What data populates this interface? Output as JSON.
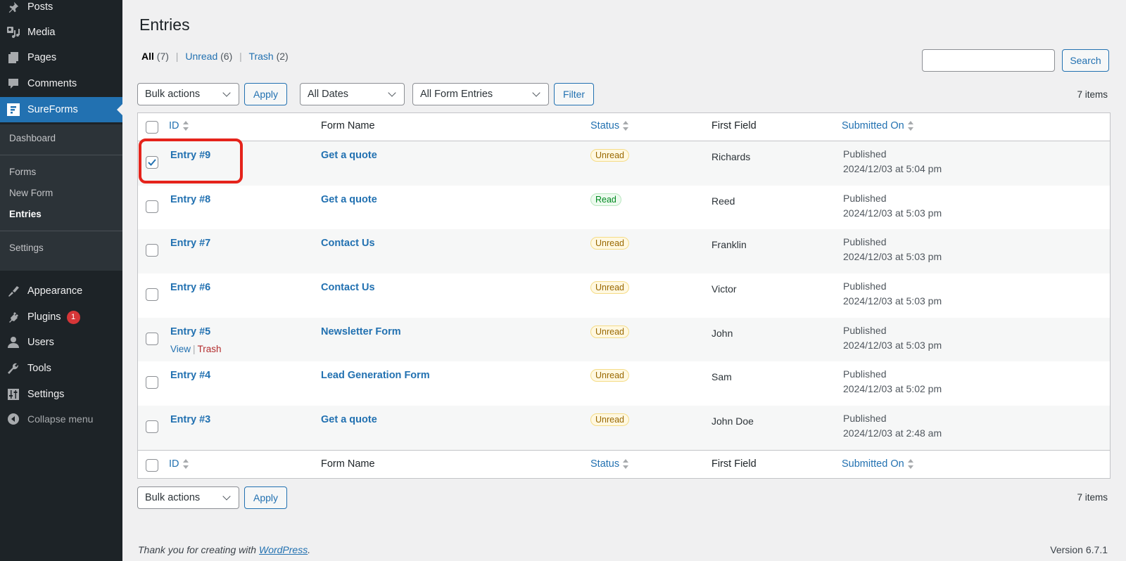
{
  "sidebar": {
    "items": [
      {
        "label": "Posts",
        "icon": "pin-icon"
      },
      {
        "label": "Media",
        "icon": "media-icon"
      },
      {
        "label": "Pages",
        "icon": "pages-icon"
      },
      {
        "label": "Comments",
        "icon": "comments-icon"
      },
      {
        "label": "SureForms",
        "icon": "sureforms-icon",
        "active": true
      },
      {
        "label": "Appearance",
        "icon": "paintbrush-icon"
      },
      {
        "label": "Plugins",
        "icon": "plugin-icon",
        "badge": "1"
      },
      {
        "label": "Users",
        "icon": "user-icon"
      },
      {
        "label": "Tools",
        "icon": "wrench-icon"
      },
      {
        "label": "Settings",
        "icon": "settings-icon"
      }
    ],
    "submenu": [
      {
        "label": "Dashboard"
      },
      {
        "label": "Forms"
      },
      {
        "label": "New Form"
      },
      {
        "label": "Entries",
        "current": true
      },
      {
        "label": "Settings"
      }
    ],
    "collapse_label": "Collapse menu"
  },
  "page": {
    "title": "Entries",
    "views": [
      {
        "label": "All",
        "count": "(7)",
        "current": true
      },
      {
        "label": "Unread",
        "count": "(6)"
      },
      {
        "label": "Trash",
        "count": "(2)"
      }
    ],
    "search": {
      "value": "",
      "button_label": "Search"
    },
    "top_nav": {
      "bulk_actions": "Bulk actions",
      "apply_label": "Apply",
      "date_filter": "All Dates",
      "form_filter": "All Form Entries",
      "filter_label": "Filter",
      "items_count": "7 items"
    },
    "bottom_nav": {
      "bulk_actions": "Bulk actions",
      "apply_label": "Apply",
      "items_count": "7 items"
    }
  },
  "table": {
    "columns": [
      {
        "label": "ID",
        "sortable": true
      },
      {
        "label": "Form Name",
        "sortable": false
      },
      {
        "label": "Status",
        "sortable": true
      },
      {
        "label": "First Field",
        "sortable": false
      },
      {
        "label": "Submitted On",
        "sortable": true
      }
    ],
    "rows": [
      {
        "id": "Entry #9",
        "form": "Get a quote",
        "status": "Unread",
        "first_field": "Richards",
        "state": "Published",
        "date": "2024/12/03 at 5:04 pm",
        "checked": true
      },
      {
        "id": "Entry #8",
        "form": "Get a quote",
        "status": "Read",
        "first_field": "Reed",
        "state": "Published",
        "date": "2024/12/03 at 5:03 pm",
        "checked": false
      },
      {
        "id": "Entry #7",
        "form": "Contact Us",
        "status": "Unread",
        "first_field": "Franklin",
        "state": "Published",
        "date": "2024/12/03 at 5:03 pm",
        "checked": false
      },
      {
        "id": "Entry #6",
        "form": "Contact Us",
        "status": "Unread",
        "first_field": "Victor",
        "state": "Published",
        "date": "2024/12/03 at 5:03 pm",
        "checked": false
      },
      {
        "id": "Entry #5",
        "form": "Newsletter Form",
        "status": "Unread",
        "first_field": "John",
        "state": "Published",
        "date": "2024/12/03 at 5:03 pm",
        "checked": false,
        "row_actions": [
          "View",
          "Trash"
        ]
      },
      {
        "id": "Entry #4",
        "form": "Lead Generation Form",
        "status": "Unread",
        "first_field": "Sam",
        "state": "Published",
        "date": "2024/12/03 at 5:02 pm",
        "checked": false
      },
      {
        "id": "Entry #3",
        "form": "Get a quote",
        "status": "Unread",
        "first_field": "John Doe",
        "state": "Published",
        "date": "2024/12/03 at 2:48 am",
        "checked": false
      }
    ]
  },
  "footer": {
    "thanks_prefix": "Thank you for creating with ",
    "thanks_link": "WordPress",
    "thanks_suffix": ".",
    "version": "Version 6.7.1"
  },
  "colors": {
    "accent": "#2271b1",
    "sidebar_bg": "#1d2327",
    "unread": "#996800",
    "read": "#008a20",
    "trash": "#b32d2e",
    "highlight": "#e5231b"
  }
}
